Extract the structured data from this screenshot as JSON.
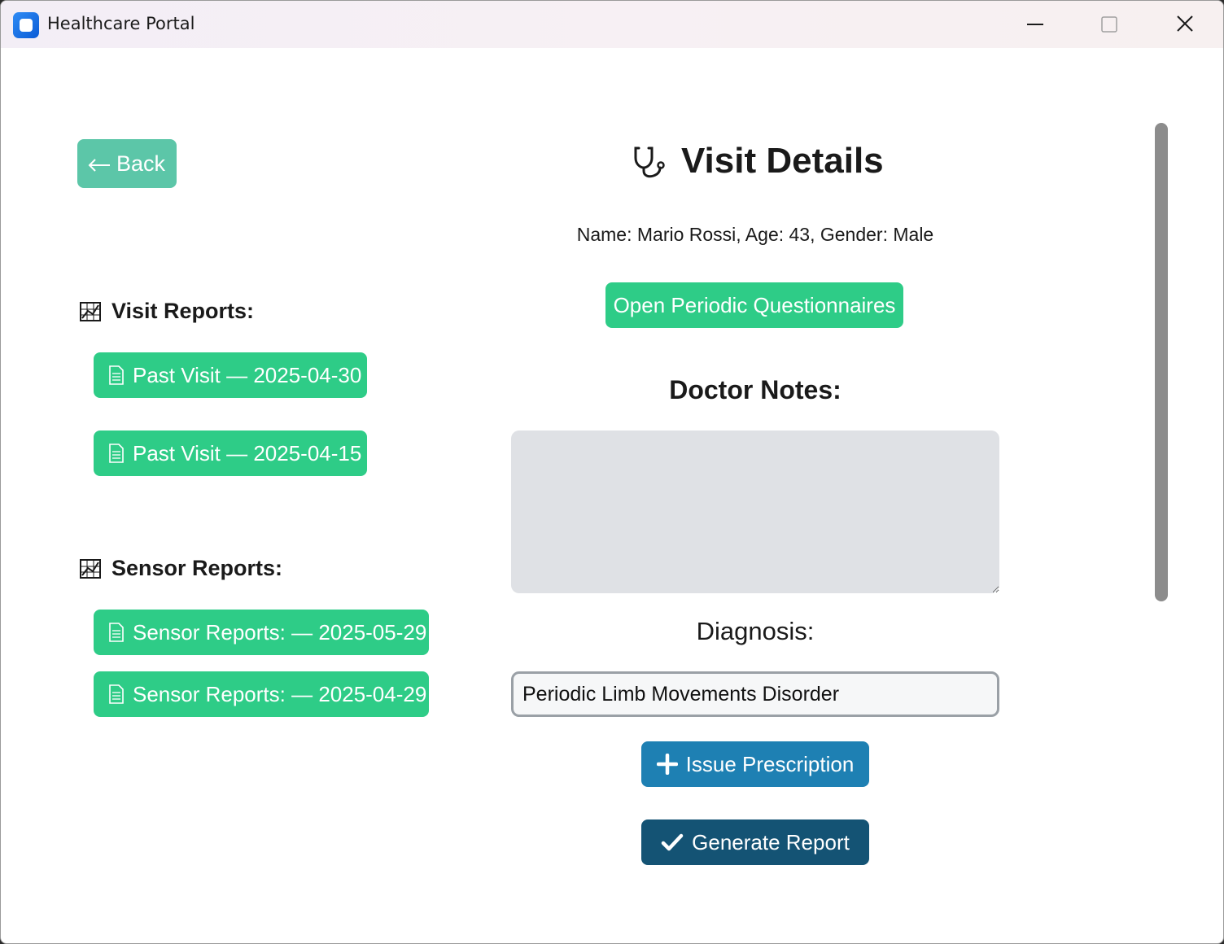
{
  "window": {
    "title": "Healthcare Portal"
  },
  "nav": {
    "back_label": "Back"
  },
  "visit_reports": {
    "heading": "Visit Reports:",
    "items": [
      {
        "label": "Past Visit — 2025-04-30"
      },
      {
        "label": "Past Visit — 2025-04-15"
      }
    ]
  },
  "sensor_reports": {
    "heading": "Sensor Reports:",
    "items": [
      {
        "label": "Sensor Reports: — 2025-05-29"
      },
      {
        "label": "Sensor Reports: — 2025-04-29"
      }
    ]
  },
  "main": {
    "title": "Visit Details",
    "patient_info": "Name: Mario Rossi, Age: 43, Gender: Male",
    "questionnaires_label": "Open Periodic Questionnaires",
    "notes_label": "Doctor Notes:",
    "notes_value": "",
    "diagnosis_label": "Diagnosis:",
    "diagnosis_value": "Periodic Limb Movements Disorder",
    "issue_prescription_label": "Issue Prescription",
    "generate_report_label": "Generate Report"
  },
  "icons": {
    "app": "app-icon",
    "back": "arrow-left-icon",
    "section": "chart-icon",
    "document": "document-icon",
    "title": "stethoscope-icon",
    "plus": "plus-icon",
    "check": "check-icon"
  },
  "colors": {
    "green_button": "#2ecc87",
    "back_button": "#5cc6a8",
    "issue_button": "#1e80b3",
    "generate_button": "#145374",
    "notes_background": "#dfe1e5"
  }
}
